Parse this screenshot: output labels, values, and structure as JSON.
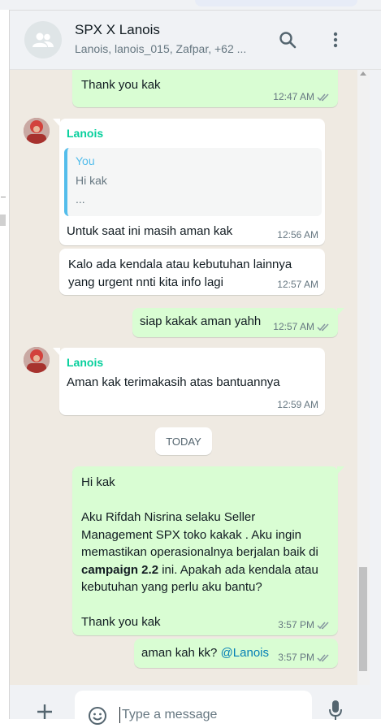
{
  "header": {
    "title": "SPX X Lanois",
    "subtitle": "Lanois, lanois_015, Zafpar, +62 ...",
    "search_icon": "search-icon",
    "menu_icon": "more-vertical-icon"
  },
  "messages": [
    {
      "dir": "out",
      "text": "Thank you kak",
      "time": "12:47 AM",
      "status": "read"
    },
    {
      "dir": "in",
      "sender": "Lanois",
      "quote_name": "You",
      "quote_line1": "Hi kak",
      "quote_line2": "...",
      "text": "Untuk saat ini masih aman kak",
      "time": "12:56 AM"
    },
    {
      "dir": "in",
      "line1": "Kalo ada kendala atau kebutuhan lainnya",
      "line2": "yang urgent nnti kita info lagi",
      "time": "12:57 AM"
    },
    {
      "dir": "out",
      "text": "siap kakak aman yahh",
      "time": "12:57 AM",
      "status": "read"
    },
    {
      "dir": "in",
      "sender": "Lanois",
      "text": "Aman kak terimakasih atas bantuannya",
      "time": "12:59 AM"
    },
    {
      "dir": "out",
      "line1": "Hi kak",
      "line3": "Aku Rifdah Nisrina selaku Seller",
      "line4": "Management SPX toko kakak . Aku ingin",
      "line5": "memastikan operasionalnya berjalan baik di",
      "line6_bold": "campaign 2.2",
      "line6_rest": " ini. Apakah ada kendala atau",
      "line7": "kebutuhan yang perlu aku bantu?",
      "line9": "Thank you kak",
      "time": "3:57 PM",
      "status": "read"
    },
    {
      "dir": "out",
      "text": "aman kah kk? ",
      "mention": "@Lanois",
      "time": "3:57 PM",
      "status": "read"
    }
  ],
  "day_separator": "TODAY",
  "composer": {
    "placeholder": "Type a message",
    "attach_icon": "plus-icon",
    "emoji_icon": "emoji-icon",
    "mic_icon": "microphone-icon"
  },
  "colors": {
    "outgoing_bubble": "#d9fdd3",
    "incoming_bubble": "#ffffff",
    "chat_background": "#efeae2",
    "sender_name": "#06cf9c",
    "read_ticks": "#8696a0",
    "mention": "#027eb5"
  }
}
